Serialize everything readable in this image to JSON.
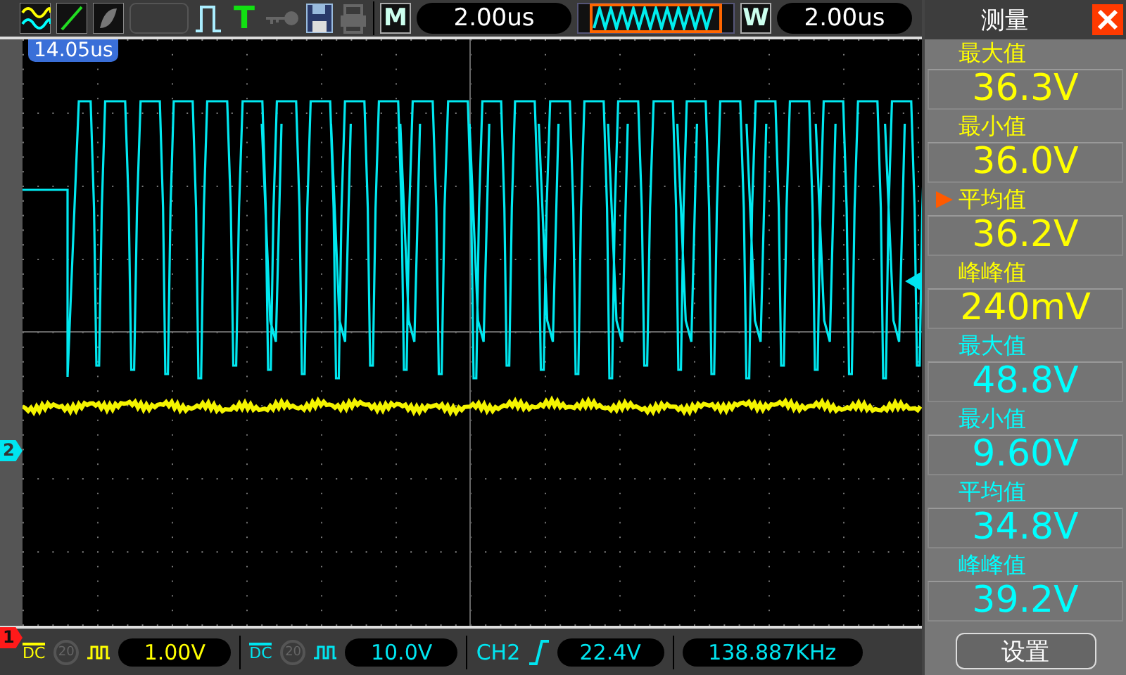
{
  "top_bar": {
    "trigger_mode": "T",
    "main_label": "M",
    "time_base": "2.00us",
    "window_label": "W",
    "window_time": "2.00us"
  },
  "screen": {
    "trigger_position": "14.05us",
    "channel_markers": [
      {
        "label": "2",
        "color": "#00e5f0"
      },
      {
        "label": "1",
        "color": "#ff1a1a"
      }
    ]
  },
  "measure_panel": {
    "title": "测量",
    "items": [
      {
        "label": "最大值",
        "value": "36.3V",
        "selected": false,
        "color": "#ffff00"
      },
      {
        "label": "最小值",
        "value": "36.0V",
        "selected": false,
        "color": "#ffff00"
      },
      {
        "label": "平均值",
        "value": "36.2V",
        "selected": true,
        "color": "#ffff00"
      },
      {
        "label": "峰峰值",
        "value": "240mV",
        "selected": false,
        "color": "#ffff00"
      },
      {
        "label": "最大值",
        "value": "48.8V",
        "selected": false,
        "color": "#00ffff"
      },
      {
        "label": "最小值",
        "value": "9.60V",
        "selected": false,
        "color": "#00ffff"
      },
      {
        "label": "平均值",
        "value": "34.8V",
        "selected": false,
        "color": "#00ffff"
      },
      {
        "label": "峰峰值",
        "value": "39.2V",
        "selected": false,
        "color": "#00ffff"
      }
    ],
    "settings_button": "设置"
  },
  "bottom_bar": {
    "channels": [
      {
        "coupling": "DC",
        "bw_limit": "20",
        "scale": "1.00V",
        "color": "#ffff00"
      },
      {
        "coupling": "DC",
        "bw_limit": "20",
        "scale": "10.0V",
        "color": "#00e5f0"
      }
    ],
    "trigger": {
      "source": "CH2",
      "level": "22.4V"
    },
    "frequency": "138.887KHz"
  }
}
